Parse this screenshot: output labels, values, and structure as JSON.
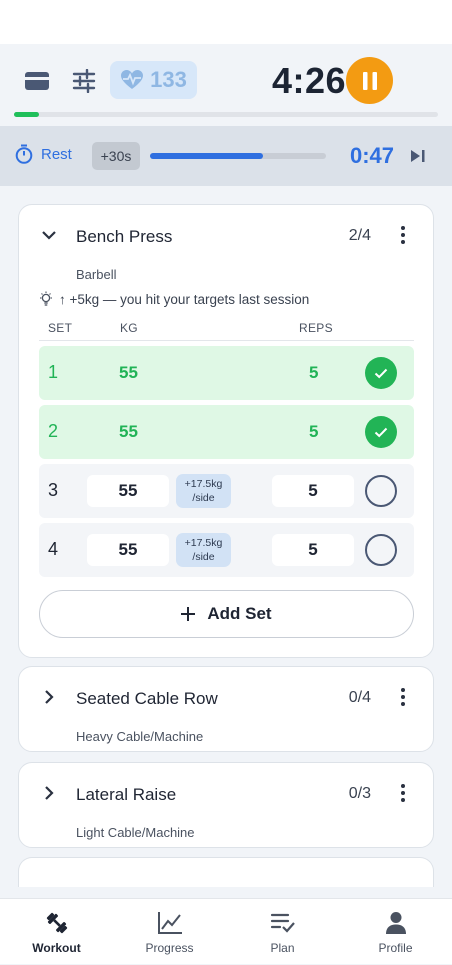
{
  "header": {
    "heart_rate": "133",
    "elapsed_time": "4:26",
    "workout_progress": 0.06
  },
  "rest": {
    "label": "Rest",
    "add_time": "+30s",
    "remaining": "0:47",
    "progress": 0.64
  },
  "exercises": [
    {
      "name": "Bench Press",
      "count": "2/4",
      "equipment": "Barbell",
      "hint": "↑ +5kg — you hit your targets last session",
      "columns": {
        "set": "SET",
        "kg": "KG",
        "reps": "REPS"
      },
      "sets": [
        {
          "num": "1",
          "kg": "55",
          "reps": "5",
          "done": true
        },
        {
          "num": "2",
          "kg": "55",
          "reps": "5",
          "done": true
        },
        {
          "num": "3",
          "kg": "55",
          "reps": "5",
          "side": "+17.5kg\n/side",
          "done": false
        },
        {
          "num": "4",
          "kg": "55",
          "reps": "5",
          "side": "+17.5kg\n/side",
          "done": false
        }
      ],
      "add_set": "Add Set"
    },
    {
      "name": "Seated Cable Row",
      "count": "0/4",
      "equipment": "Heavy Cable/Machine"
    },
    {
      "name": "Lateral Raise",
      "count": "0/3",
      "equipment": "Light Cable/Machine"
    }
  ],
  "tabs": [
    {
      "label": "Workout",
      "icon": "dumbbell-icon",
      "active": true
    },
    {
      "label": "Progress",
      "icon": "chart-icon",
      "active": false
    },
    {
      "label": "Plan",
      "icon": "checklist-icon",
      "active": false
    },
    {
      "label": "Profile",
      "icon": "person-icon",
      "active": false
    }
  ],
  "colors": {
    "accent_blue": "#2f6fe0",
    "success_green": "#22b456",
    "pause_orange": "#f39b12"
  }
}
